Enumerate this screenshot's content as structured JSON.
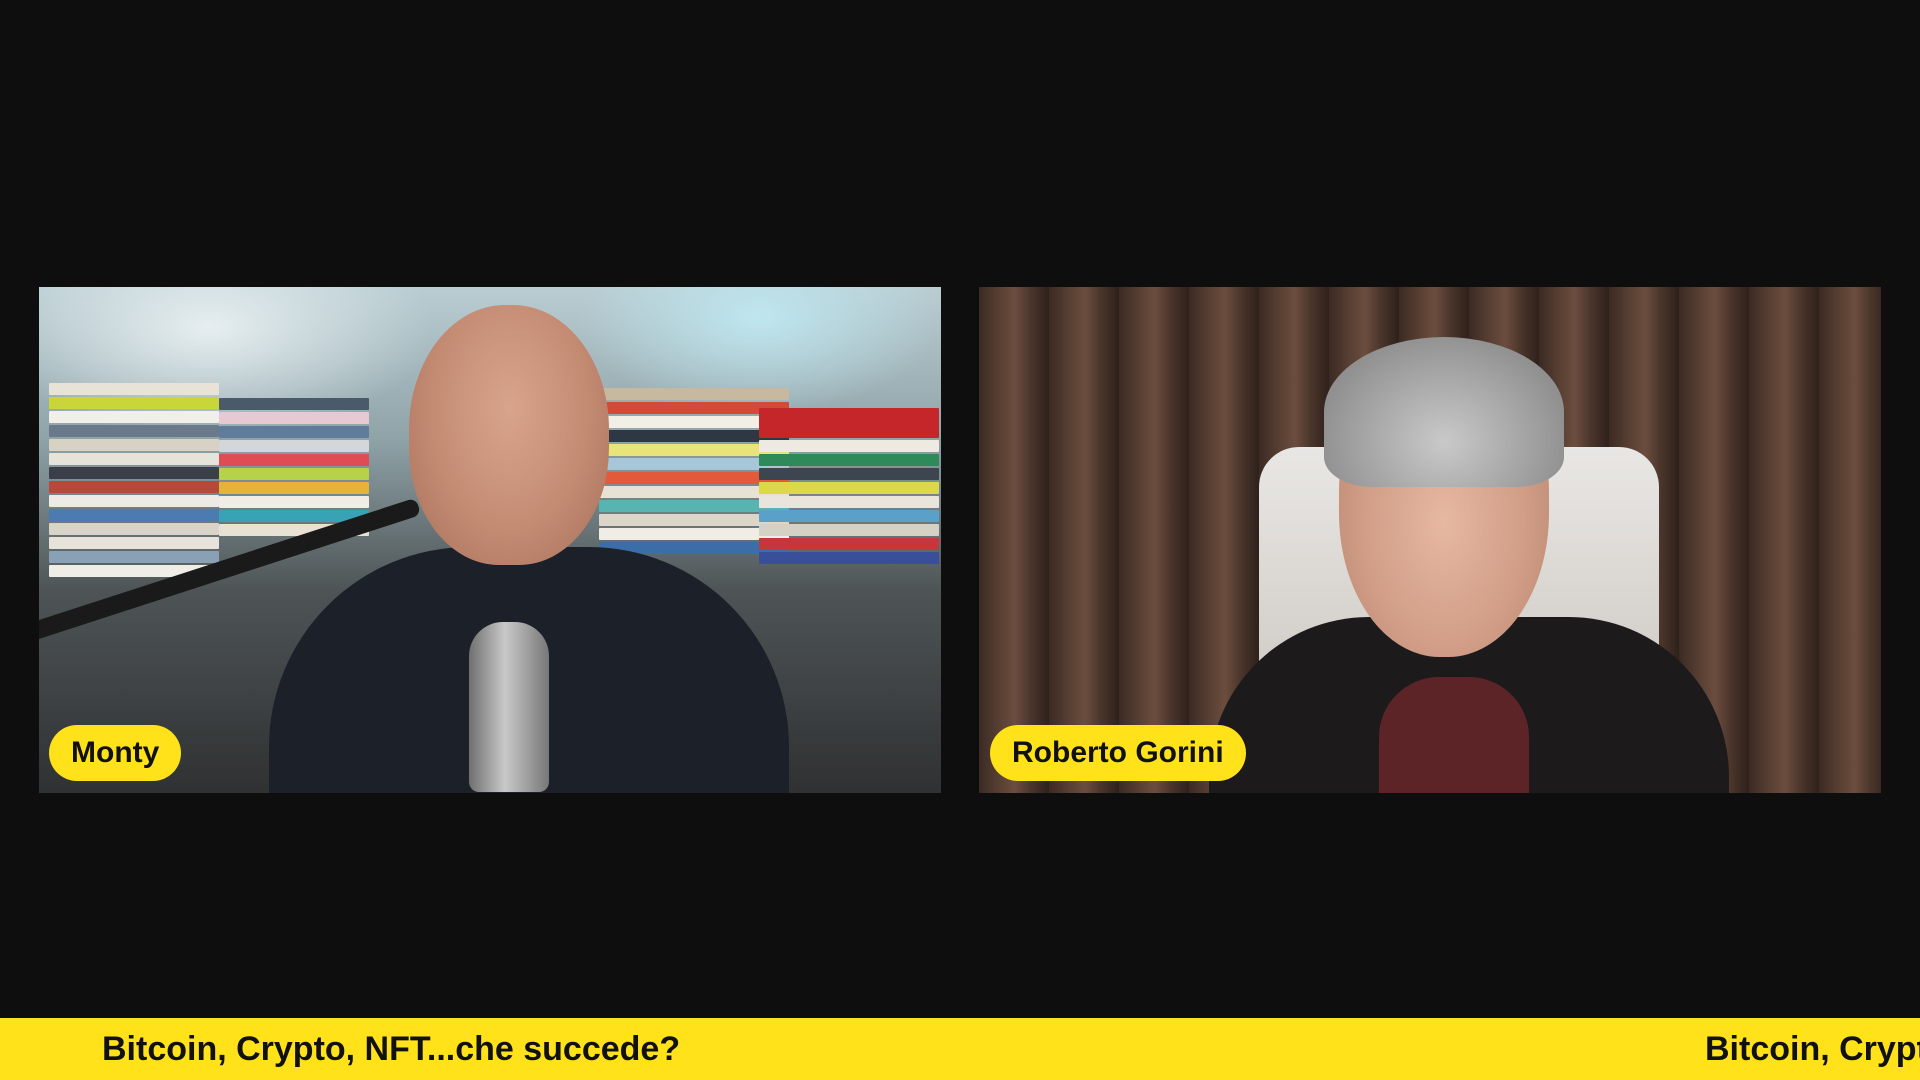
{
  "participants": [
    {
      "name": "Monty"
    },
    {
      "name": "Roberto Gorini"
    }
  ],
  "ticker": {
    "text": "Bitcoin, Crypto, NFT...che succede?"
  },
  "colors": {
    "accent": "#ffe21a",
    "background": "#0e0e0e",
    "label_text": "#111111"
  }
}
